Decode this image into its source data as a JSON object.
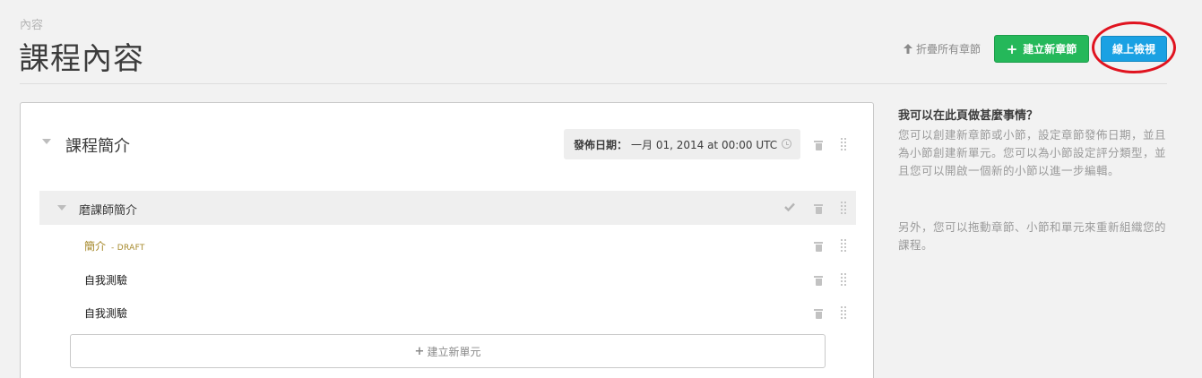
{
  "header": {
    "breadcrumb": "內容",
    "title": "課程內容",
    "collapse_all": "折疊所有章節",
    "new_section_button": "建立新章節",
    "view_live_button": "線上檢視"
  },
  "section": {
    "title": "課程簡介",
    "release_label": "發佈日期：",
    "release_value": "一月 01, 2014 at 00:00 UTC",
    "subsection": {
      "title": "磨課師簡介",
      "units": [
        {
          "title": "簡介",
          "status": "- DRAFT"
        },
        {
          "title": "自我測驗"
        },
        {
          "title": "自我測驗"
        }
      ],
      "new_unit_button": "建立新單元"
    }
  },
  "help": {
    "title": "我可以在此頁做甚麼事情？",
    "paragraph1": "您可以創建新章節或小節，設定章節發佈日期，並且為小節創建新單元。您可以為小節設定評分類型，並且您可以開啟一個新的小節以進一步編輯。",
    "paragraph2": "另外，您可以拖動章節、小節和單元來重新組織您的課程。"
  },
  "colors": {
    "new_section_button": "#25b85a",
    "view_live_button": "#1aa1e3",
    "highlight_circle": "#e0131f",
    "draft_text": "#a6892b"
  }
}
